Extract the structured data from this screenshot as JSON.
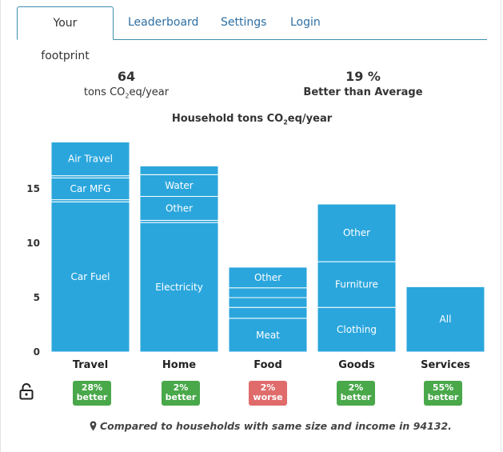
{
  "tabs": [
    {
      "label": "Your footprint",
      "active": true
    },
    {
      "label": "Leaderboard",
      "active": false
    },
    {
      "label": "Settings",
      "active": false
    },
    {
      "label": "Login",
      "active": false
    }
  ],
  "stats": {
    "total": {
      "value": "64",
      "unit_pre": "tons CO",
      "unit_sub": "2",
      "unit_post": "eq/year"
    },
    "comparison": {
      "value": "19 %",
      "label": "Better than Average"
    }
  },
  "chart_title": {
    "pre": "Household tons CO",
    "sub": "2",
    "post": "eq/year"
  },
  "chart_data": {
    "type": "bar",
    "stacked": true,
    "ylim": [
      0,
      19.5
    ],
    "yticks": [
      0,
      5,
      10,
      15
    ],
    "categories": [
      "Travel",
      "Home",
      "Food",
      "Goods",
      "Services"
    ],
    "stacks": [
      {
        "category": "Travel",
        "segments": [
          {
            "label": "Car Fuel",
            "value": 13.8
          },
          {
            "label": "",
            "value": 0.2
          },
          {
            "label": "Car MFG",
            "value": 2.0
          },
          {
            "label": "",
            "value": 0.2
          },
          {
            "label": "Air Travel",
            "value": 3.1
          }
        ]
      },
      {
        "category": "Home",
        "segments": [
          {
            "label": "Electricity",
            "value": 11.9
          },
          {
            "label": "",
            "value": 0.2
          },
          {
            "label": "Other",
            "value": 2.2
          },
          {
            "label": "Water",
            "value": 2.0
          },
          {
            "label": "",
            "value": 0.8
          }
        ]
      },
      {
        "category": "Food",
        "segments": [
          {
            "label": "Meat",
            "value": 3.1
          },
          {
            "label": "",
            "value": 1.0
          },
          {
            "label": "",
            "value": 0.9
          },
          {
            "label": "",
            "value": 0.9
          },
          {
            "label": "Other",
            "value": 1.9
          }
        ]
      },
      {
        "category": "Goods",
        "segments": [
          {
            "label": "Clothing",
            "value": 4.1
          },
          {
            "label": "Furniture",
            "value": 4.2
          },
          {
            "label": "Other",
            "value": 5.3
          }
        ]
      },
      {
        "category": "Services",
        "segments": [
          {
            "label": "All",
            "value": 6.0
          }
        ]
      }
    ],
    "bar_color": "#2aa6dd",
    "separator_color": "#ffffff"
  },
  "badges": [
    {
      "pct": "28%",
      "text": "better",
      "status": "better"
    },
    {
      "pct": "2%",
      "text": "better",
      "status": "better"
    },
    {
      "pct": "2%",
      "text": "worse",
      "status": "worse"
    },
    {
      "pct": "2%",
      "text": "better",
      "status": "better"
    },
    {
      "pct": "55%",
      "text": "better",
      "status": "better"
    }
  ],
  "colors": {
    "better": "#49a84a",
    "worse": "#e06b6b",
    "tab_link": "#2e6fa3"
  },
  "footnote": "Compared to households with same size and income in 94132.",
  "icons": {
    "lock": "lock-icon",
    "pin": "map-pin-icon"
  }
}
